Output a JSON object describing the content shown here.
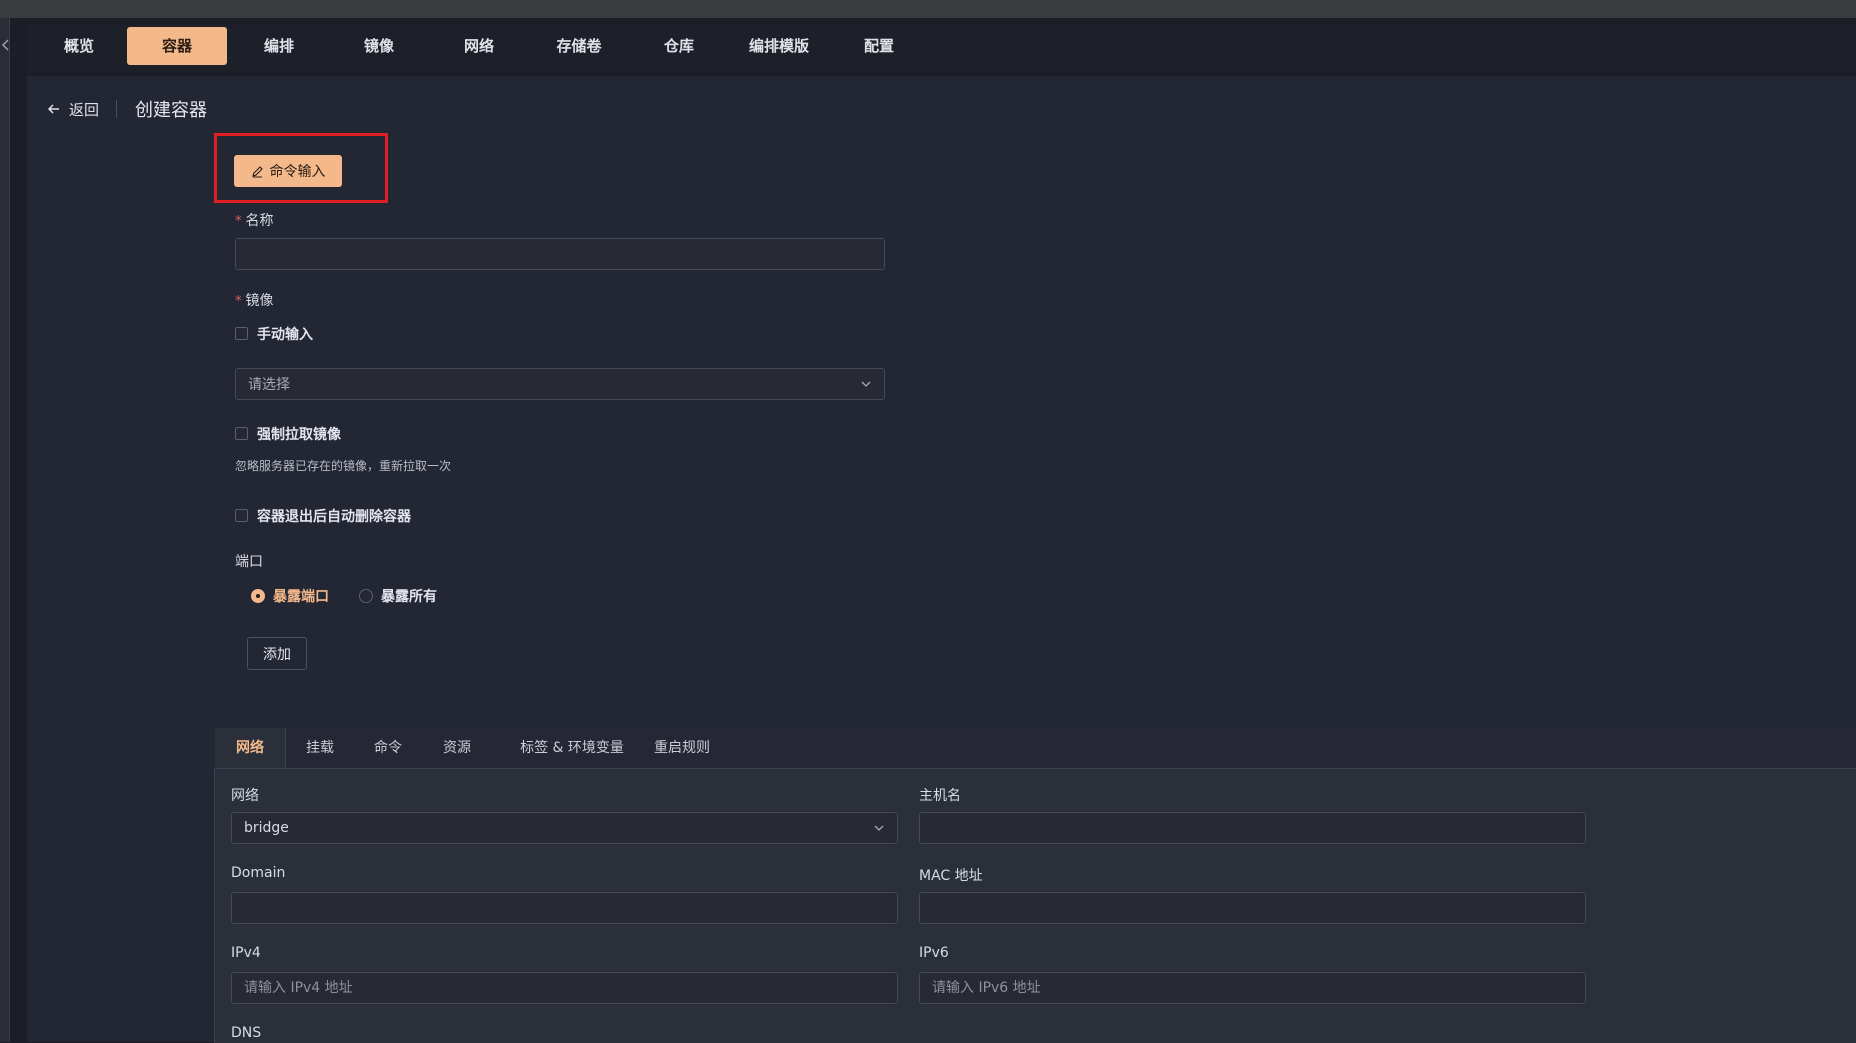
{
  "nav": {
    "items": [
      "概览",
      "容器",
      "编排",
      "镜像",
      "网络",
      "存储卷",
      "仓库",
      "编排模版",
      "配置"
    ],
    "active_index": 1
  },
  "header": {
    "back_label": "返回",
    "title": "创建容器"
  },
  "form": {
    "command_input_label": "命令输入",
    "name_label": "名称",
    "name_value": "",
    "image_label": "镜像",
    "manual_input_label": "手动输入",
    "image_select_placeholder": "请选择",
    "force_pull_label": "强制拉取镜像",
    "force_pull_hint": "忽略服务器已存在的镜像，重新拉取一次",
    "auto_remove_label": "容器退出后自动删除容器",
    "port_label": "端口",
    "port_options": [
      "暴露端口",
      "暴露所有"
    ],
    "port_selected": "暴露端口",
    "add_label": "添加"
  },
  "tabs": {
    "items": [
      "网络",
      "挂载",
      "命令",
      "资源",
      "标签 & 环境变量",
      "重启规则"
    ],
    "active_index": 0
  },
  "network_tab": {
    "network_label": "网络",
    "network_value": "bridge",
    "hostname_label": "主机名",
    "hostname_value": "",
    "domain_label": "Domain",
    "domain_value": "",
    "mac_label": "MAC 地址",
    "mac_value": "",
    "ipv4_label": "IPv4",
    "ipv4_placeholder": "请输入 IPv4 地址",
    "ipv6_label": "IPv6",
    "ipv6_placeholder": "请输入 IPv6 地址",
    "dns_label": "DNS"
  },
  "colors": {
    "accent": "#f4b98a",
    "highlight_border": "#e11d24",
    "background": "#1b1e27"
  }
}
